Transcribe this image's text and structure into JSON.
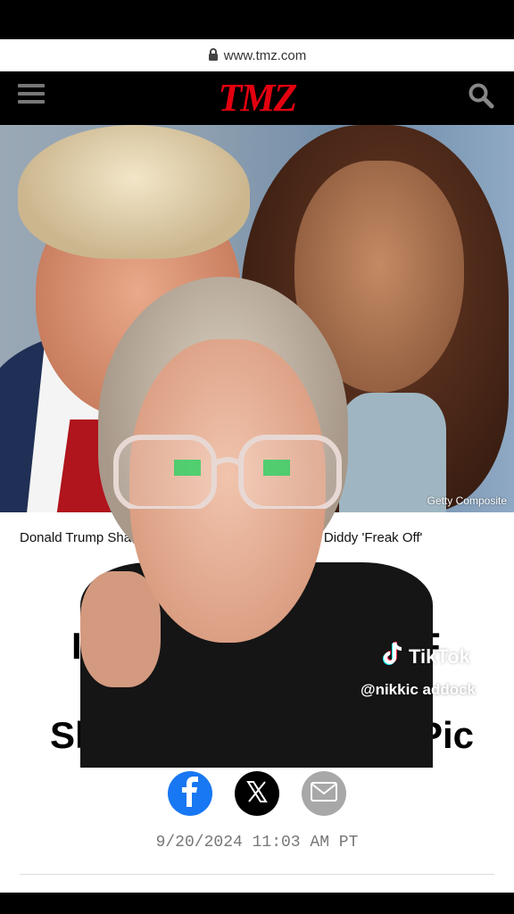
{
  "browser": {
    "url": "www.tmz.com"
  },
  "header": {
    "logo_text": "TMZ",
    "brand_color": "#e3000f"
  },
  "hero": {
    "credit": "Getty Composite"
  },
  "article": {
    "subheadline_left": "Donald Trump Sha",
    "subheadline_right": "s at a Diddy 'Freak Off'",
    "title_line1_left": "I",
    "title_line1_right": "F",
    "title_line2_left": "Sh",
    "title_line2_right": "Pic",
    "date": "9/20/2024 11:03 AM PT"
  },
  "overlay": {
    "tiktok_label": "TikTok",
    "tiktok_handle": "@nikkic addock"
  },
  "share": {
    "icons": [
      "facebook-icon",
      "x-icon",
      "mail-icon"
    ],
    "colors": {
      "facebook": "#1877f2",
      "x": "#000000",
      "mail": "#a8a8a8"
    }
  }
}
